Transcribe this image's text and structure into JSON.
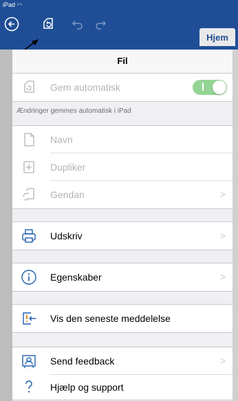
{
  "statusbar": {
    "device": "iPad"
  },
  "toolbar": {
    "tab_label": "Hjem"
  },
  "panel": {
    "title": "Fil",
    "autosave": {
      "label": "Gem automatisk",
      "enabled": true
    },
    "autosave_note": "Ændringer gemmes automatisk i iPad",
    "file_items": [
      {
        "label": "Navn",
        "icon": "document-icon"
      },
      {
        "label": "Dupliker",
        "icon": "duplicate-icon"
      },
      {
        "label": "Gendan",
        "icon": "restore-icon"
      }
    ],
    "print": {
      "label": "Udskriv",
      "icon": "printer-icon"
    },
    "properties": {
      "label": "Egenskaber",
      "icon": "info-icon"
    },
    "latest_message": {
      "label": "Vis den seneste meddelelse",
      "icon": "notification-icon"
    },
    "feedback": {
      "label": "Send feedback",
      "icon": "feedback-icon"
    },
    "help": {
      "label": "Hjælp og support",
      "icon": "question-icon"
    }
  },
  "colors": {
    "toolbar_bg": "#1f4e96",
    "toggle_on": "#8ad08a",
    "disabled_text": "#b4b4b8"
  }
}
